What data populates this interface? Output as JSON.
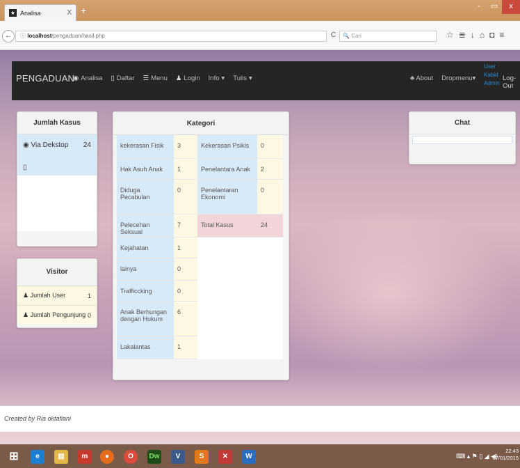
{
  "browser": {
    "tab_title": "Analisa",
    "tab_close": "X",
    "new_tab": "+",
    "url_host": "localhost",
    "url_path": "/pengaduan/hasil.php",
    "search_placeholder": "Cari",
    "win_min": "-",
    "win_max": "▭",
    "win_close": "x"
  },
  "navbar": {
    "brand": "PENGADUAN",
    "items": [
      {
        "label": "Analisa",
        "icon": "globe-icon"
      },
      {
        "label": "Daftar",
        "icon": "mobile-icon"
      },
      {
        "label": "Menu",
        "icon": "list-icon"
      },
      {
        "label": "Login",
        "icon": "user-icon"
      },
      {
        "label": "Info",
        "icon": "caret-down-icon"
      },
      {
        "label": "Tulis",
        "icon": "caret-down-icon"
      }
    ],
    "about": "About",
    "dropmenu": "Dropmenu",
    "users": [
      "User",
      "Kabid",
      "Admin"
    ],
    "logout": "Log-Out"
  },
  "jumlah_kasus": {
    "title": "Jumlah Kasus",
    "via_label": "Via Dekstop",
    "via_value": "24"
  },
  "visitor": {
    "title": "Visitor",
    "rows": [
      {
        "label": "Jumlah User",
        "value": "1"
      },
      {
        "label": "Jumlah Pengunjung",
        "value": "0"
      }
    ]
  },
  "kategori": {
    "title": "Kategori",
    "left": [
      {
        "label": "kekerasan Fisik",
        "value": "3"
      },
      {
        "label": "Hak Asuh Anak",
        "value": "1"
      },
      {
        "label": "Diduga Pecabulan",
        "value": "0"
      },
      {
        "label": "Pelecehan Seksual",
        "value": "7"
      },
      {
        "label": "Kejahatan",
        "value": "1"
      },
      {
        "label": "lainya",
        "value": "0"
      },
      {
        "label": "Trafficcking",
        "value": "0"
      },
      {
        "label": "Anak Berhungan dengan Hukum",
        "value": "6"
      },
      {
        "label": "Lakalantas",
        "value": "1"
      }
    ],
    "right": [
      {
        "label": "Kekerasan Psikis",
        "value": "0"
      },
      {
        "label": "Penelantara Anak",
        "value": "2"
      },
      {
        "label": "Penelantaran Ekonomi",
        "value": "0"
      },
      {
        "label": "Total Kasus",
        "value": "24"
      }
    ]
  },
  "chat": {
    "title": "Chat"
  },
  "footer": {
    "text": "Created by Ria oktafiani"
  },
  "taskbar": {
    "time": "22:43",
    "date": "07/01/2015"
  }
}
